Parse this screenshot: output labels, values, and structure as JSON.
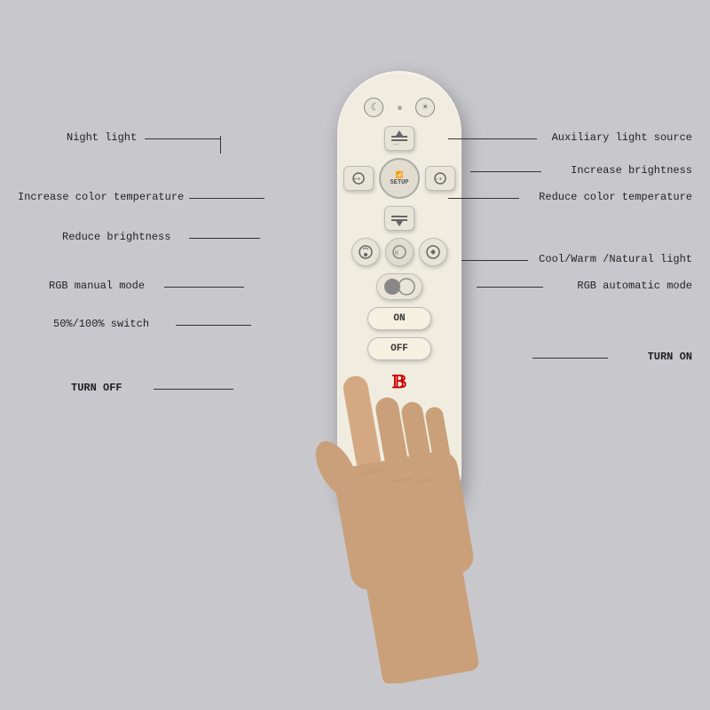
{
  "labels": {
    "night_light": "Night light",
    "auxiliary_light": "Auxiliary light source",
    "increase_brightness": "Increase brightness",
    "increase_color_temp": "Increase color temperature",
    "reduce_color_temp": "Reduce color temperature",
    "reduce_brightness": "Reduce brightness",
    "cool_warm": "Cool/Warm /Natural light",
    "rgb_manual": "RGB manual mode",
    "rgb_auto": "RGB automatic mode",
    "switch_50_100": "50%/100% switch",
    "turn_on": "TURN ON",
    "turn_off": "TURN OFF"
  },
  "remote": {
    "setup_label": "SETUP",
    "on_label": "ON",
    "off_label": "OFF"
  }
}
